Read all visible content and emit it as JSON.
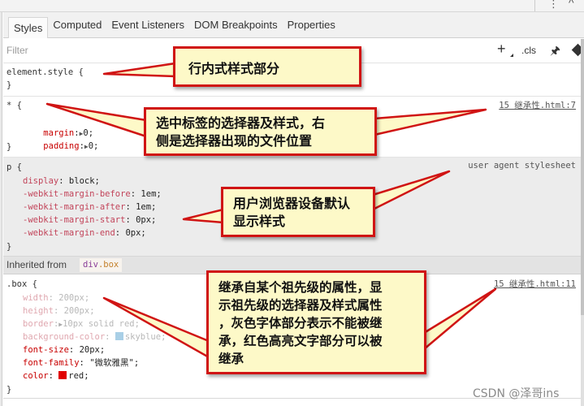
{
  "window": {
    "kebab_icon": "⋮",
    "close_icon": "^"
  },
  "tabs": [
    {
      "label": "Styles",
      "active": true
    },
    {
      "label": "Computed"
    },
    {
      "label": "Event Listeners"
    },
    {
      "label": "DOM Breakpoints"
    },
    {
      "label": "Properties"
    }
  ],
  "toolbar": {
    "filter_placeholder": "Filter",
    "add_rule_label": "+",
    "cls_label": ".cls",
    "pin_icon": "🖈"
  },
  "rules": {
    "element_style": {
      "selector": "element.style {",
      "close": "}"
    },
    "star": {
      "selector": "* {",
      "source": "15 继承性.html:7",
      "props": [
        {
          "name": "margin",
          "value": "0;"
        },
        {
          "name": "padding",
          "value": "0;"
        }
      ],
      "close": "}"
    },
    "user_agent": {
      "selector": "p {",
      "source": "user agent stylesheet",
      "props": [
        {
          "name": "display",
          "value": "block;"
        },
        {
          "name": "-webkit-margin-before",
          "value": "1em;"
        },
        {
          "name": "-webkit-margin-after",
          "value": "1em;"
        },
        {
          "name": "-webkit-margin-start",
          "value": "0px;"
        },
        {
          "name": "-webkit-margin-end",
          "value": "0px;"
        }
      ],
      "close": "}"
    },
    "inherited": {
      "label": "Inherited from",
      "tag": "div",
      "class": ".box"
    },
    "box": {
      "selector": ".box {",
      "source": "15 继承性.html:11",
      "props": [
        {
          "name": "width",
          "value": "200px;",
          "inherited": false
        },
        {
          "name": "height",
          "value": "200px;",
          "inherited": false
        },
        {
          "name": "border",
          "value": "10px solid red;",
          "inherited": false
        },
        {
          "name": "background-color",
          "value": "skyblue;",
          "inherited": false
        },
        {
          "name": "font-size",
          "value": "20px;",
          "inherited": true
        },
        {
          "name": "font-family",
          "value": "\"微软雅黑\";",
          "inherited": true
        },
        {
          "name": "color",
          "value": "red;",
          "inherited": true
        }
      ],
      "close": "}"
    }
  },
  "colors": {
    "red_swatch": "#e00000",
    "skyblue_swatch": "#a9cfe6",
    "callout_fill": "#fdf9c8",
    "callout_border": "#d01414"
  },
  "callouts": {
    "inline": [
      "行内式样式部分"
    ],
    "selector": [
      "选中标签的选择器及样式，右",
      "侧是选择器出现的文件位置"
    ],
    "user_agent": [
      "用户浏览器设备默认",
      "显示样式"
    ],
    "inherited": [
      "继承自某个祖先级的属性，显",
      "示祖先级的选择器及样式属性",
      "，灰色字体部分表示不能被继",
      "承，红色高亮文字部分可以被",
      "继承"
    ]
  },
  "watermark": "CSDN @泽哥ins"
}
